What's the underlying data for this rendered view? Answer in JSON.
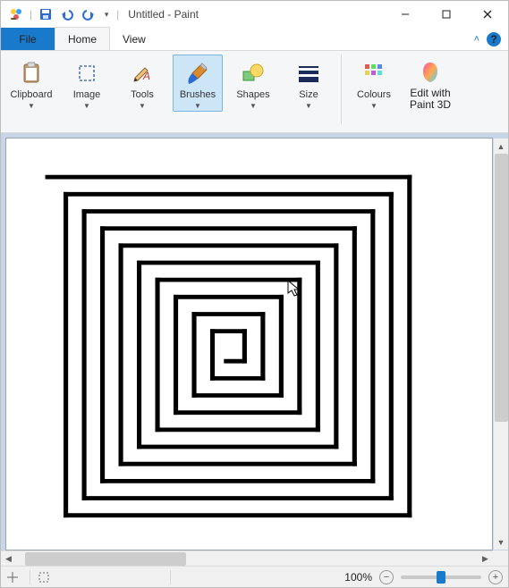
{
  "qat": {
    "save": "save",
    "undo": "undo",
    "redo": "redo"
  },
  "title": "Untitled - Paint",
  "window_controls": {
    "min": "min",
    "max": "max",
    "close": "close"
  },
  "tabs": {
    "file": "File",
    "home": "Home",
    "view": "View"
  },
  "help": "?",
  "ribbon": {
    "clipboard": "Clipboard",
    "image": "Image",
    "tools": "Tools",
    "brushes": "Brushes",
    "shapes": "Shapes",
    "size": "Size",
    "colours": "Colours",
    "edit3d_line1": "Edit with",
    "edit3d_line2": "Paint 3D"
  },
  "status": {
    "zoom_label": "100%",
    "zoom_value": 100
  }
}
